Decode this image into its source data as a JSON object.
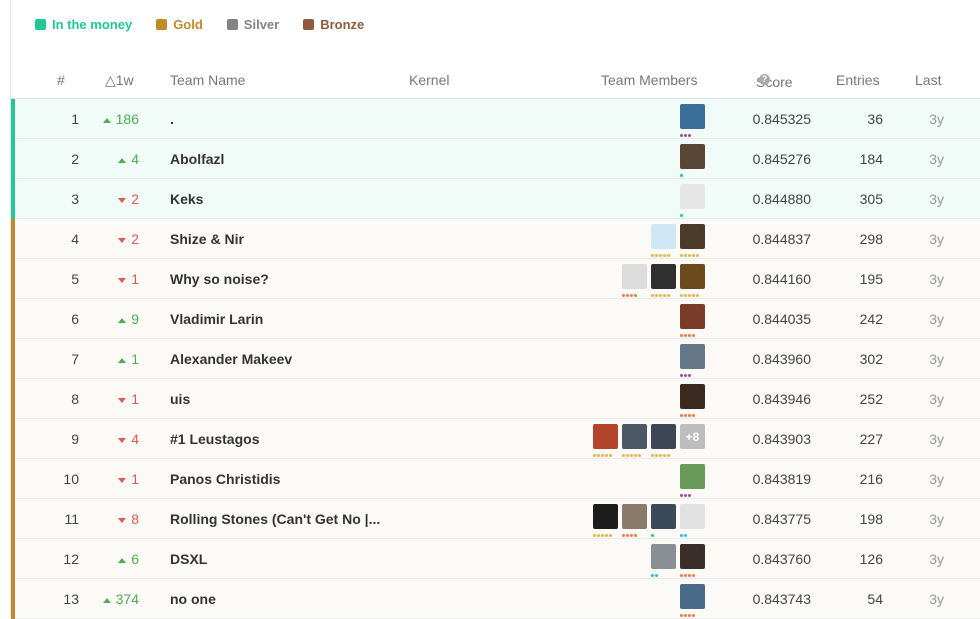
{
  "legend": [
    {
      "label": "In the money",
      "color": "#20beff",
      "text_color": "#20c997",
      "swatch": "#20c997"
    },
    {
      "label": "Gold",
      "color": "#c08a2b",
      "text_color": "#c08a2b",
      "swatch": "#c08a2b"
    },
    {
      "label": "Silver",
      "color": "#838383",
      "text_color": "#838383",
      "swatch": "#838383"
    },
    {
      "label": "Bronze",
      "color": "#8e5b3d",
      "text_color": "#8e5b3d",
      "swatch": "#8e5b3d"
    }
  ],
  "headers": {
    "rank": "#",
    "delta": "△1w",
    "team": "Team Name",
    "kernel": "Kernel",
    "members": "Team Members",
    "score": "Score",
    "score_help": "?",
    "entries": "Entries",
    "last": "Last"
  },
  "colors": {
    "money": "#20c997",
    "gold": "#c08a2b",
    "money_bg": "#f1fcf8",
    "gold_bg": "#fcfaf6"
  },
  "rows": [
    {
      "rank": "1",
      "dir": "up",
      "delta": "186",
      "team": ".",
      "score": "0.845325",
      "entries": "36",
      "last": "3y",
      "tier": "money",
      "members": [
        {
          "color": "#3a6f9a",
          "dots": [
            "#a34c9b",
            "#a34c9b",
            "#a34c9b"
          ]
        }
      ]
    },
    {
      "rank": "2",
      "dir": "up",
      "delta": "4",
      "team": "Abolfazl",
      "score": "0.845276",
      "entries": "184",
      "last": "3y",
      "tier": "money",
      "members": [
        {
          "color": "#5a4636",
          "dots": [
            "#20c997"
          ]
        }
      ]
    },
    {
      "rank": "3",
      "dir": "down",
      "delta": "2",
      "team": "Keks",
      "score": "0.844880",
      "entries": "305",
      "last": "3y",
      "tier": "money",
      "members": [
        {
          "color": "#e6e6e6",
          "dots": [
            "#20c997"
          ]
        }
      ]
    },
    {
      "rank": "4",
      "dir": "down",
      "delta": "2",
      "team": "Shize & Nir",
      "score": "0.844837",
      "entries": "298",
      "last": "3y",
      "tier": "gold",
      "members": [
        {
          "color": "#cfe6f5",
          "dots": [
            "#e9b44c",
            "#e9b44c",
            "#e9b44c",
            "#e9b44c",
            "#e9b44c"
          ]
        },
        {
          "color": "#4b3a2a",
          "dots": [
            "#e9b44c",
            "#e9b44c",
            "#e9b44c",
            "#e9b44c",
            "#e9b44c"
          ]
        }
      ]
    },
    {
      "rank": "5",
      "dir": "down",
      "delta": "1",
      "team": "Why so noise?",
      "score": "0.844160",
      "entries": "195",
      "last": "3y",
      "tier": "gold",
      "members": [
        {
          "color": "#dcdcdc",
          "dots": [
            "#f07b3f",
            "#f07b3f",
            "#f07b3f",
            "#f07b3f"
          ]
        },
        {
          "color": "#2f2f2f",
          "dots": [
            "#e9b44c",
            "#e9b44c",
            "#e9b44c",
            "#e9b44c",
            "#e9b44c"
          ]
        },
        {
          "color": "#6b4a1d",
          "dots": [
            "#e9b44c",
            "#e9b44c",
            "#e9b44c",
            "#e9b44c",
            "#e9b44c"
          ]
        }
      ]
    },
    {
      "rank": "6",
      "dir": "up",
      "delta": "9",
      "team": "Vladimir Larin",
      "score": "0.844035",
      "entries": "242",
      "last": "3y",
      "tier": "gold",
      "members": [
        {
          "color": "#7a3b2a",
          "dots": [
            "#f07b3f",
            "#f07b3f",
            "#f07b3f",
            "#f07b3f"
          ]
        }
      ]
    },
    {
      "rank": "7",
      "dir": "up",
      "delta": "1",
      "team": "Alexander Makeev",
      "score": "0.843960",
      "entries": "302",
      "last": "3y",
      "tier": "gold",
      "members": [
        {
          "color": "#667788",
          "dots": [
            "#a34c9b",
            "#a34c9b",
            "#a34c9b"
          ]
        }
      ]
    },
    {
      "rank": "8",
      "dir": "down",
      "delta": "1",
      "team": "uis",
      "score": "0.843946",
      "entries": "252",
      "last": "3y",
      "tier": "gold",
      "members": [
        {
          "color": "#3a2a20",
          "dots": [
            "#f07b3f",
            "#f07b3f",
            "#f07b3f",
            "#f07b3f"
          ]
        }
      ]
    },
    {
      "rank": "9",
      "dir": "down",
      "delta": "4",
      "team": "#1 Leustagos",
      "score": "0.843903",
      "entries": "227",
      "last": "3y",
      "tier": "gold",
      "members": [
        {
          "color": "#b5442c",
          "dots": [
            "#e9b44c",
            "#e9b44c",
            "#e9b44c",
            "#e9b44c",
            "#e9b44c"
          ]
        },
        {
          "color": "#4c5866",
          "dots": [
            "#e9b44c",
            "#e9b44c",
            "#e9b44c",
            "#e9b44c",
            "#e9b44c"
          ]
        },
        {
          "color": "#3c4654",
          "dots": [
            "#e9b44c",
            "#e9b44c",
            "#e9b44c",
            "#e9b44c",
            "#e9b44c"
          ]
        }
      ],
      "more": "+8"
    },
    {
      "rank": "10",
      "dir": "down",
      "delta": "1",
      "team": "Panos Christidis",
      "score": "0.843819",
      "entries": "216",
      "last": "3y",
      "tier": "gold",
      "members": [
        {
          "color": "#6a9a5a",
          "dots": [
            "#a34c9b",
            "#a34c9b",
            "#a34c9b"
          ]
        }
      ]
    },
    {
      "rank": "11",
      "dir": "down",
      "delta": "8",
      "team": "Rolling Stones (Can't Get No |...",
      "score": "0.843775",
      "entries": "198",
      "last": "3y",
      "tier": "gold",
      "members": [
        {
          "color": "#1d1d1d",
          "dots": [
            "#e9b44c",
            "#e9b44c",
            "#e9b44c",
            "#e9b44c",
            "#e9b44c"
          ]
        },
        {
          "color": "#8a7a6a",
          "dots": [
            "#f07b3f",
            "#f07b3f",
            "#f07b3f",
            "#f07b3f"
          ]
        },
        {
          "color": "#3a4a5a",
          "dots": [
            "#20c997"
          ]
        },
        {
          "color": "#e2e2e2",
          "dots": [
            "#20beff",
            "#20beff"
          ]
        }
      ]
    },
    {
      "rank": "12",
      "dir": "up",
      "delta": "6",
      "team": "DSXL",
      "score": "0.843760",
      "entries": "126",
      "last": "3y",
      "tier": "gold",
      "members": [
        {
          "color": "#8a8f95",
          "dots": [
            "#20beff",
            "#20beff"
          ]
        },
        {
          "color": "#3a2f2a",
          "dots": [
            "#f07b3f",
            "#f07b3f",
            "#f07b3f",
            "#f07b3f"
          ]
        }
      ]
    },
    {
      "rank": "13",
      "dir": "up",
      "delta": "374",
      "team": "no one",
      "score": "0.843743",
      "entries": "54",
      "last": "3y",
      "tier": "gold",
      "members": [
        {
          "color": "#4a6a8a",
          "dots": [
            "#f07b3f",
            "#f07b3f",
            "#f07b3f",
            "#f07b3f"
          ]
        }
      ]
    }
  ]
}
